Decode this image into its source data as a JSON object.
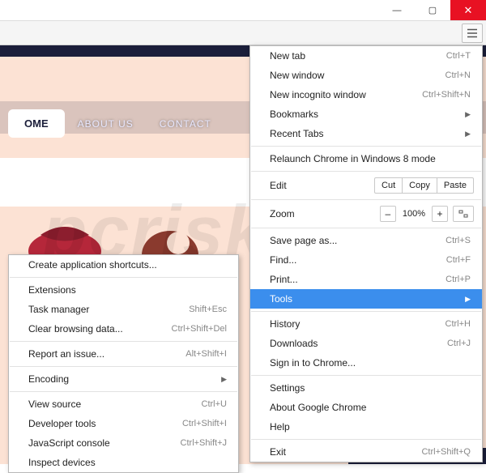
{
  "titlebar": {
    "min": "—",
    "max": "▢",
    "close": "✕"
  },
  "nav": {
    "home": "OME",
    "about": "ABOUT US",
    "contact": "CONTACT"
  },
  "watermark": "pcrisk.com",
  "main_menu": {
    "new_tab": {
      "label": "New tab",
      "shortcut": "Ctrl+T"
    },
    "new_window": {
      "label": "New window",
      "shortcut": "Ctrl+N"
    },
    "incognito": {
      "label": "New incognito window",
      "shortcut": "Ctrl+Shift+N"
    },
    "bookmarks": {
      "label": "Bookmarks"
    },
    "recent": {
      "label": "Recent Tabs"
    },
    "relaunch": {
      "label": "Relaunch Chrome in Windows 8 mode"
    },
    "edit": {
      "label": "Edit",
      "cut": "Cut",
      "copy": "Copy",
      "paste": "Paste"
    },
    "zoom": {
      "label": "Zoom",
      "minus": "–",
      "value": "100%",
      "plus": "+"
    },
    "save": {
      "label": "Save page as...",
      "shortcut": "Ctrl+S"
    },
    "find": {
      "label": "Find...",
      "shortcut": "Ctrl+F"
    },
    "print": {
      "label": "Print...",
      "shortcut": "Ctrl+P"
    },
    "tools": {
      "label": "Tools"
    },
    "history": {
      "label": "History",
      "shortcut": "Ctrl+H"
    },
    "downloads": {
      "label": "Downloads",
      "shortcut": "Ctrl+J"
    },
    "signin": {
      "label": "Sign in to Chrome..."
    },
    "settings": {
      "label": "Settings"
    },
    "about": {
      "label": "About Google Chrome"
    },
    "help": {
      "label": "Help"
    },
    "exit": {
      "label": "Exit",
      "shortcut": "Ctrl+Shift+Q"
    }
  },
  "sub_menu": {
    "shortcuts": {
      "label": "Create application shortcuts..."
    },
    "extensions": {
      "label": "Extensions"
    },
    "task_mgr": {
      "label": "Task manager",
      "shortcut": "Shift+Esc"
    },
    "clear": {
      "label": "Clear browsing data...",
      "shortcut": "Ctrl+Shift+Del"
    },
    "report": {
      "label": "Report an issue...",
      "shortcut": "Alt+Shift+I"
    },
    "encoding": {
      "label": "Encoding"
    },
    "view_src": {
      "label": "View source",
      "shortcut": "Ctrl+U"
    },
    "dev_tools": {
      "label": "Developer tools",
      "shortcut": "Ctrl+Shift+I"
    },
    "js_console": {
      "label": "JavaScript console",
      "shortcut": "Ctrl+Shift+J"
    },
    "inspect": {
      "label": "Inspect devices"
    }
  }
}
